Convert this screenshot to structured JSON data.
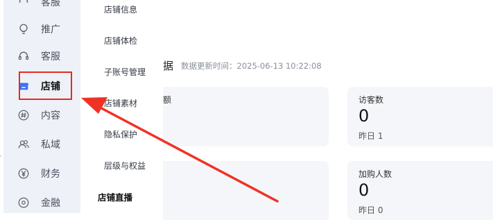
{
  "sidebar": {
    "items": [
      {
        "label": "客服",
        "icon": "headset-icon"
      },
      {
        "label": "推广",
        "icon": "bulb-icon"
      },
      {
        "label": "客服",
        "icon": "headset-icon"
      },
      {
        "label": "店铺",
        "icon": "store-icon",
        "active": true
      },
      {
        "label": "内容",
        "icon": "hashtag-icon"
      },
      {
        "label": "私域",
        "icon": "users-icon"
      },
      {
        "label": "财务",
        "icon": "yen-icon"
      },
      {
        "label": "金融",
        "icon": "finance-icon"
      }
    ]
  },
  "submenu": {
    "items": [
      "店铺信息",
      "店铺体检",
      "子账号管理",
      "店铺素材",
      "隐私保护",
      "层级与权益"
    ],
    "strong_item": "店铺直播"
  },
  "main": {
    "section_title_tail": "据",
    "update_time": "数据更新时间：2025-06-13 10:22:08",
    "cards": [
      {
        "title": "访客数",
        "value": "0",
        "yesterday": "昨日 1"
      },
      {
        "title": "加购人数",
        "value": "0",
        "yesterday": "昨日 0"
      }
    ],
    "left_card_title_tail": "额"
  },
  "colors": {
    "sidebar_bg": "#eef1f7",
    "highlight": "#e22b22",
    "store_icon": "#3f6df5",
    "card_bg": "#f5f6f9"
  }
}
